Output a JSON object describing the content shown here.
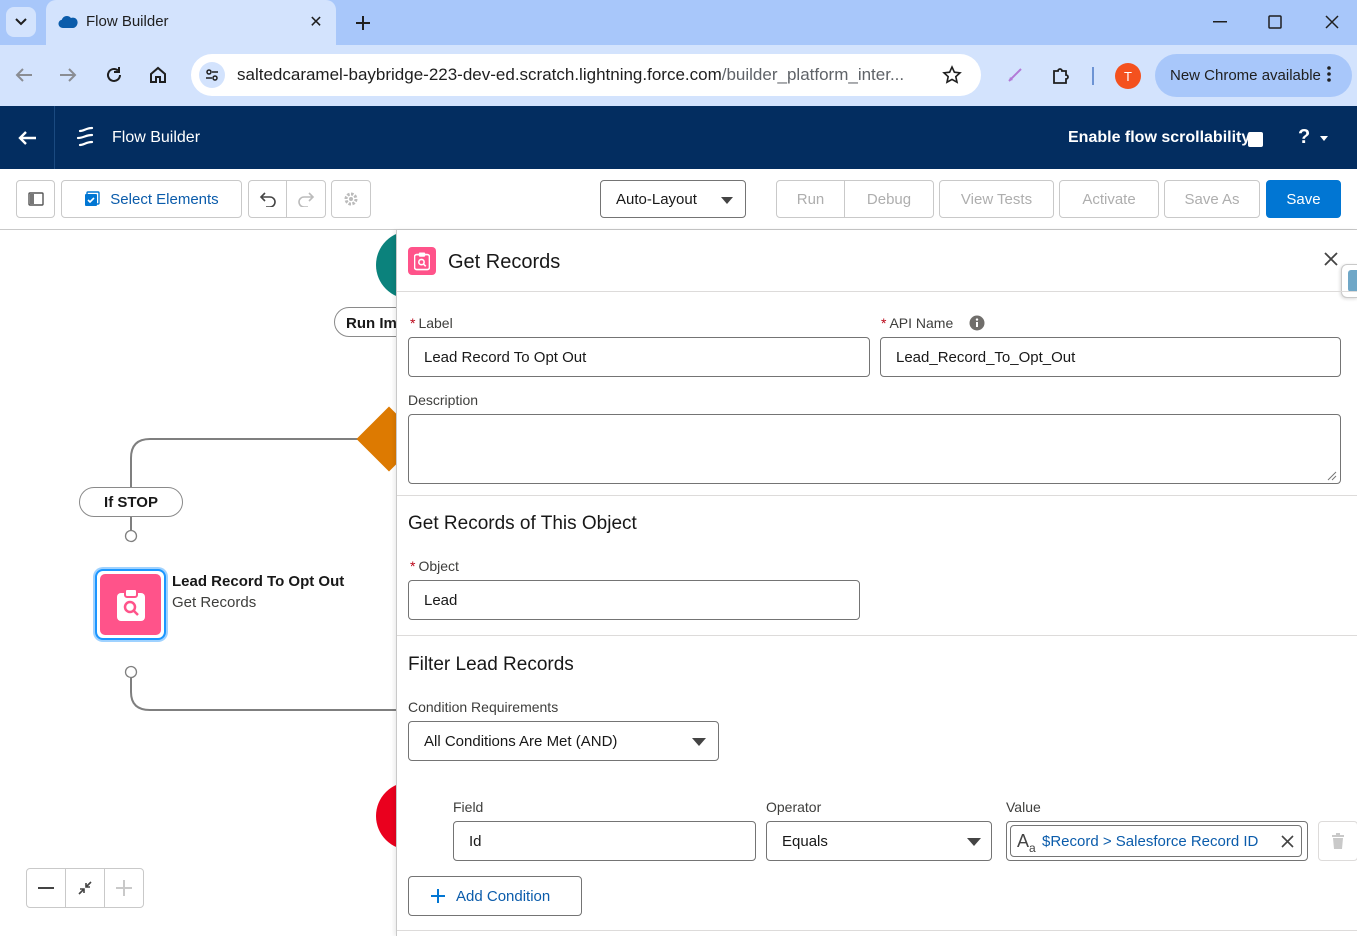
{
  "browser": {
    "tab_title": "Flow Builder",
    "url_main": "saltedcaramel-baybridge-223-dev-ed.scratch.lightning.force.com",
    "url_path": "/builder_platform_inter...",
    "profile_initial": "T",
    "update_label": "New Chrome available"
  },
  "header": {
    "app_title": "Flow Builder",
    "scroll_label": "Enable flow scrollability",
    "help_label": "?"
  },
  "toolbar": {
    "select_elements": "Select Elements",
    "layout_value": "Auto-Layout",
    "run": "Run",
    "debug": "Debug",
    "view_tests": "View Tests",
    "activate": "Activate",
    "save_as": "Save As",
    "save": "Save"
  },
  "canvas": {
    "run_pill": "Run Im",
    "branch_label": "If STOP",
    "node_title": "Lead Record To Opt Out",
    "node_subtitle": "Get Records",
    "zoom_out": "—",
    "zoom_in": "+"
  },
  "panel": {
    "title": "Get Records",
    "label_label": "Label",
    "label_value": "Lead Record To Opt Out",
    "api_label": "API Name",
    "api_value": "Lead_Record_To_Opt_Out",
    "description_label": "Description",
    "description_value": "",
    "object_section": "Get Records of This Object",
    "object_label": "Object",
    "object_value": "Lead",
    "filter_section": "Filter Lead Records",
    "cond_req_label": "Condition Requirements",
    "cond_req_value": "All Conditions Are Met (AND)",
    "field_col": "Field",
    "operator_col": "Operator",
    "value_col": "Value",
    "condition_field": "Id",
    "condition_operator": "Equals",
    "condition_value": "$Record > Salesforce Record ID",
    "add_condition": "Add Condition"
  },
  "colors": {
    "brand_blue": "#0176d3",
    "header_navy": "#032d60",
    "node_pink": "#ff538a",
    "decision_orange": "#dd7a01",
    "start_teal": "#0b827c",
    "end_red": "#ea001e"
  }
}
